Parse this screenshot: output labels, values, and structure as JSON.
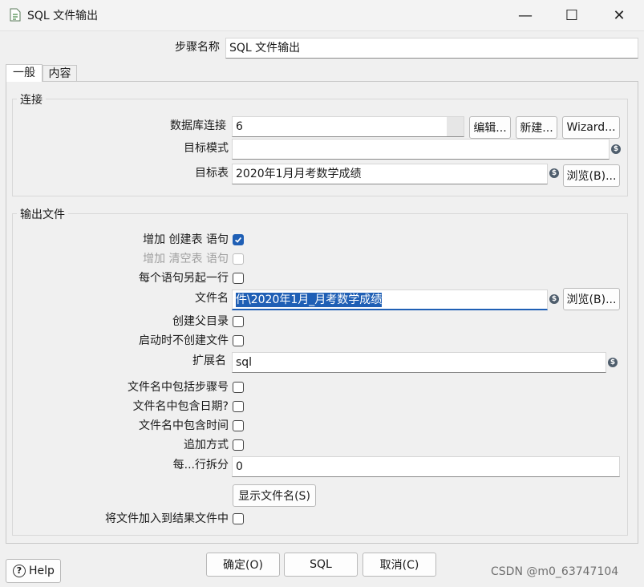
{
  "window": {
    "title": "SQL 文件输出",
    "minimize_glyph": "—",
    "maximize_glyph": "☐",
    "close_glyph": "✕"
  },
  "step_name": {
    "label": "步骤名称",
    "value": "SQL 文件输出"
  },
  "tabs": [
    {
      "label": "一般"
    },
    {
      "label": "内容"
    }
  ],
  "connection": {
    "title": "连接",
    "db_label": "数据库连接",
    "db_value": "6",
    "edit_btn": "编辑...",
    "new_btn": "新建...",
    "wizard_btn": "Wizard...",
    "schema_label": "目标模式",
    "schema_value": "",
    "table_label": "目标表",
    "table_value": "2020年1月月考数学成绩",
    "browse_btn": "浏览(B)..."
  },
  "output": {
    "title": "输出文件",
    "create_table_label": "增加 创建表 语句",
    "truncate_label": "增加 清空表 语句",
    "newline_label": "每个语句另起一行",
    "filename_label": "文件名",
    "filename_value": "件\\2020年1月_月考数学成绩",
    "browse_btn": "浏览(B)...",
    "create_parent_label": "创建父目录",
    "no_create_label": "启动时不创建文件",
    "ext_label": "扩展名",
    "ext_value": "sql",
    "stepnr_label": "文件名中包括步骤号",
    "date_label": "文件名中包含日期?",
    "time_label": "文件名中包含时间",
    "append_label": "追加方式",
    "split_label": "每...行拆分",
    "split_value": "0",
    "show_files_btn": "显示文件名(S)",
    "add_result_label": "将文件加入到结果文件中"
  },
  "checkboxes": {
    "create_table": true,
    "truncate": false,
    "newline": false,
    "create_parent": false,
    "no_create": false,
    "stepnr": false,
    "date": false,
    "time": false,
    "append": false,
    "add_result": false
  },
  "var_icon_glyph": "$",
  "footer": {
    "help": "Help",
    "help_glyph": "?",
    "ok": "确定(O)",
    "sql": "SQL",
    "cancel": "取消(C)",
    "watermark": "CSDN @m0_63747104"
  }
}
